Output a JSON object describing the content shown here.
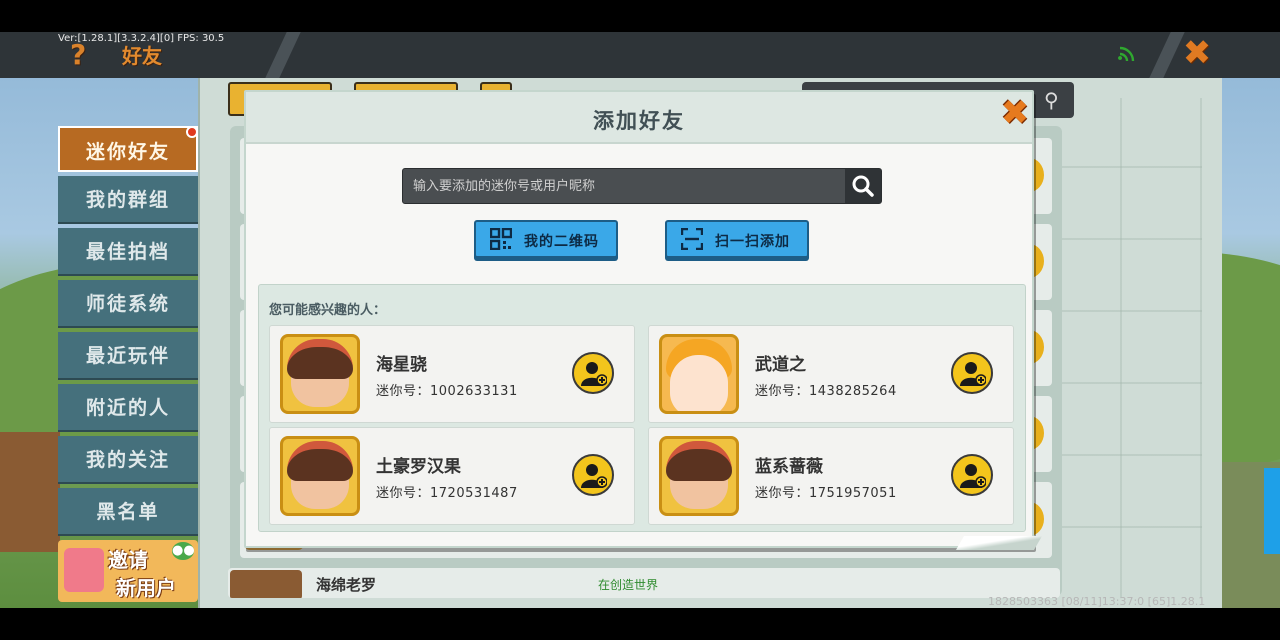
{
  "debug": {
    "version_text": "Ver:[1.28.1][3.3.2.4][0] FPS: 30.5",
    "footer_text": "1828503363   [08/11]13:37:0  [65]1.28.1"
  },
  "header": {
    "help_icon": "?",
    "title": "好友",
    "close_icon": "✖"
  },
  "sidebar": {
    "items": [
      {
        "label": "迷你好友"
      },
      {
        "label": "我的群组"
      },
      {
        "label": "最佳拍档"
      },
      {
        "label": "师徒系统"
      },
      {
        "label": "最近玩伴"
      },
      {
        "label": "附近的人"
      },
      {
        "label": "我的关注"
      },
      {
        "label": "黑名单"
      }
    ],
    "invite": {
      "line1": "邀请",
      "line2": "新用户"
    }
  },
  "background_list": {
    "bottom_name": "海绵老罗",
    "bottom_status": "在创造世界"
  },
  "modal": {
    "title": "添加好友",
    "close_icon": "✖",
    "search": {
      "placeholder": "输入要添加的迷你号或用户昵称",
      "value": ""
    },
    "buttons": {
      "my_qr": "我的二维码",
      "scan_add": "扫一扫添加"
    },
    "suggest_label": "您可能感兴趣的人：",
    "users": [
      {
        "name": "海星骁",
        "id_label": "迷你号：",
        "id": "1002633131",
        "avatar": "brown-hair-girl"
      },
      {
        "name": "武道之",
        "id_label": "迷你号：",
        "id": "1438285264",
        "avatar": "blonde-girl"
      },
      {
        "name": "土豪罗汉果",
        "id_label": "迷你号：",
        "id": "1720531487",
        "avatar": "brown-hair-girl"
      },
      {
        "name": "蓝系蔷薇",
        "id_label": "迷你号：",
        "id": "1751957051",
        "avatar": "brown-hair-girl"
      }
    ]
  },
  "colors": {
    "accent_orange": "#e28a2e",
    "button_blue": "#3aa8e8",
    "add_yellow": "#f3c51c",
    "sidebar_teal": "#45707c"
  }
}
